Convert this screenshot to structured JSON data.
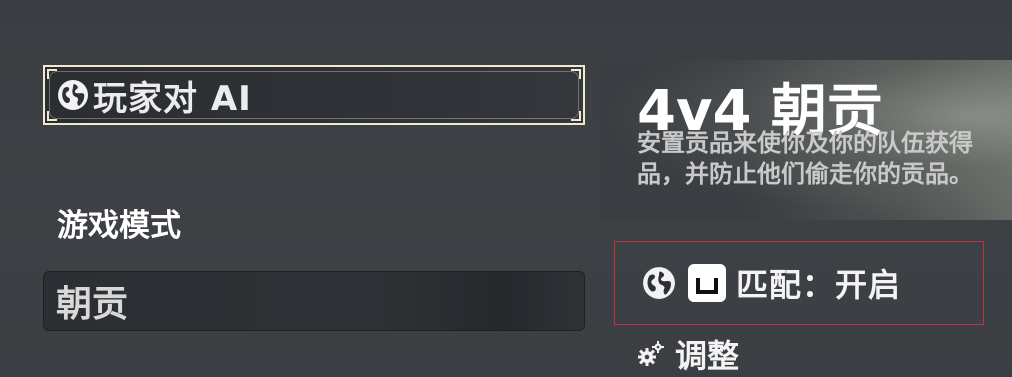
{
  "mode_selector": {
    "label": "玩家对 AI",
    "icon": "globe-icon"
  },
  "game_mode_section": {
    "label": "游戏模式"
  },
  "mode_list": {
    "selected_label": "朝贡"
  },
  "detail_panel": {
    "title": "4v4 朝贡",
    "description": "安置贡品来使你及你的队伍获得品，并防止他们偷走你的贡品。"
  },
  "matching": {
    "icon": "globe-icon",
    "key_icon": "spacebar-key-icon",
    "label": "匹配：开启",
    "highlight_color": "#c0343b"
  },
  "adjust": {
    "icon": "gears-icon",
    "label": "调整"
  },
  "colors": {
    "background": "#3c3f43",
    "selector_border": "#efe9cf",
    "text": "#ffffff"
  }
}
